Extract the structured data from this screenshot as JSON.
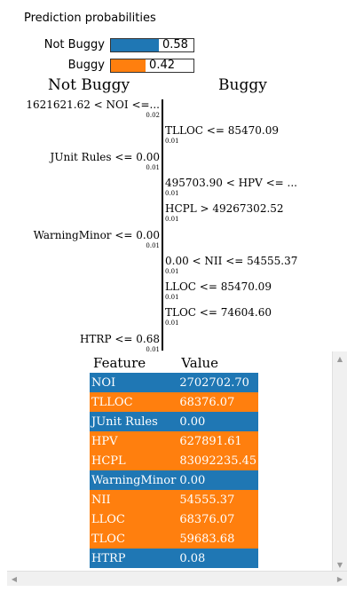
{
  "prediction_title": "Prediction probabilities",
  "colors": {
    "not_buggy": "#1f77b4",
    "buggy": "#ff7f0e"
  },
  "probabilities": [
    {
      "label": "Not Buggy",
      "value": 0.58,
      "value_text": "0.58",
      "color": "#1f77b4"
    },
    {
      "label": "Buggy",
      "value": 0.42,
      "value_text": "0.42",
      "color": "#ff7f0e"
    }
  ],
  "class_headers": {
    "left": "Not Buggy",
    "right": "Buggy"
  },
  "chart_data": {
    "type": "bar",
    "orientation": "horizontal",
    "categories": [
      "1621621.62 < NOI <=...",
      "TLLOC <= 85470.09",
      "JUnit Rules <= 0.00",
      "495703.90 < HPV <= ...",
      "HCPL > 49267302.52",
      "WarningMinor <= 0.00",
      "0.00 < NII <= 54555.37",
      "LLOC <= 85470.09",
      "TLOC <= 74604.60",
      "HTRP <= 0.68"
    ],
    "weight_labels": [
      "0.02",
      "0.01",
      "0.01",
      "0.01",
      "0.01",
      "0.01",
      "0.01",
      "0.01",
      "0.01",
      "0.01"
    ],
    "sides": [
      "Not Buggy",
      "Buggy",
      "Not Buggy",
      "Buggy",
      "Buggy",
      "Not Buggy",
      "Buggy",
      "Buggy",
      "Buggy",
      "Not Buggy"
    ]
  },
  "table": {
    "headers": [
      "Feature",
      "Value"
    ],
    "rows": [
      {
        "feature": "NOI",
        "value": "2702702.70",
        "side": "Not Buggy"
      },
      {
        "feature": "TLLOC",
        "value": "68376.07",
        "side": "Buggy"
      },
      {
        "feature": "JUnit Rules",
        "value": "0.00",
        "side": "Not Buggy"
      },
      {
        "feature": "HPV",
        "value": "627891.61",
        "side": "Buggy"
      },
      {
        "feature": "HCPL",
        "value": "83092235.45",
        "side": "Buggy"
      },
      {
        "feature": "WarningMinor",
        "value": "0.00",
        "side": "Not Buggy"
      },
      {
        "feature": "NII",
        "value": "54555.37",
        "side": "Buggy"
      },
      {
        "feature": "LLOC",
        "value": "68376.07",
        "side": "Buggy"
      },
      {
        "feature": "TLOC",
        "value": "59683.68",
        "side": "Buggy"
      },
      {
        "feature": "HTRP",
        "value": "0.08",
        "side": "Not Buggy"
      }
    ]
  }
}
